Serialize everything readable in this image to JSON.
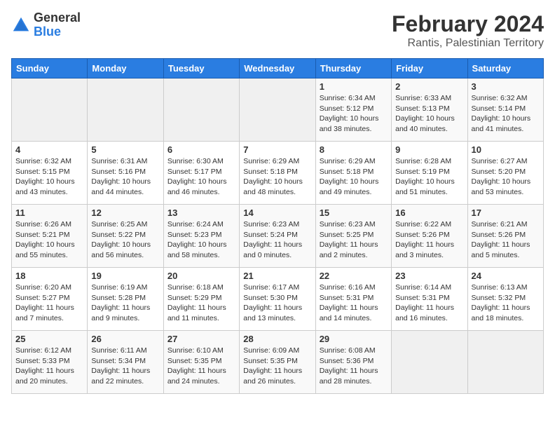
{
  "header": {
    "logo_general": "General",
    "logo_blue": "Blue",
    "title": "February 2024",
    "subtitle": "Rantis, Palestinian Territory"
  },
  "weekdays": [
    "Sunday",
    "Monday",
    "Tuesday",
    "Wednesday",
    "Thursday",
    "Friday",
    "Saturday"
  ],
  "weeks": [
    [
      {
        "day": "",
        "info": ""
      },
      {
        "day": "",
        "info": ""
      },
      {
        "day": "",
        "info": ""
      },
      {
        "day": "",
        "info": ""
      },
      {
        "day": "1",
        "info": "Sunrise: 6:34 AM\nSunset: 5:12 PM\nDaylight: 10 hours\nand 38 minutes."
      },
      {
        "day": "2",
        "info": "Sunrise: 6:33 AM\nSunset: 5:13 PM\nDaylight: 10 hours\nand 40 minutes."
      },
      {
        "day": "3",
        "info": "Sunrise: 6:32 AM\nSunset: 5:14 PM\nDaylight: 10 hours\nand 41 minutes."
      }
    ],
    [
      {
        "day": "4",
        "info": "Sunrise: 6:32 AM\nSunset: 5:15 PM\nDaylight: 10 hours\nand 43 minutes."
      },
      {
        "day": "5",
        "info": "Sunrise: 6:31 AM\nSunset: 5:16 PM\nDaylight: 10 hours\nand 44 minutes."
      },
      {
        "day": "6",
        "info": "Sunrise: 6:30 AM\nSunset: 5:17 PM\nDaylight: 10 hours\nand 46 minutes."
      },
      {
        "day": "7",
        "info": "Sunrise: 6:29 AM\nSunset: 5:18 PM\nDaylight: 10 hours\nand 48 minutes."
      },
      {
        "day": "8",
        "info": "Sunrise: 6:29 AM\nSunset: 5:18 PM\nDaylight: 10 hours\nand 49 minutes."
      },
      {
        "day": "9",
        "info": "Sunrise: 6:28 AM\nSunset: 5:19 PM\nDaylight: 10 hours\nand 51 minutes."
      },
      {
        "day": "10",
        "info": "Sunrise: 6:27 AM\nSunset: 5:20 PM\nDaylight: 10 hours\nand 53 minutes."
      }
    ],
    [
      {
        "day": "11",
        "info": "Sunrise: 6:26 AM\nSunset: 5:21 PM\nDaylight: 10 hours\nand 55 minutes."
      },
      {
        "day": "12",
        "info": "Sunrise: 6:25 AM\nSunset: 5:22 PM\nDaylight: 10 hours\nand 56 minutes."
      },
      {
        "day": "13",
        "info": "Sunrise: 6:24 AM\nSunset: 5:23 PM\nDaylight: 10 hours\nand 58 minutes."
      },
      {
        "day": "14",
        "info": "Sunrise: 6:23 AM\nSunset: 5:24 PM\nDaylight: 11 hours\nand 0 minutes."
      },
      {
        "day": "15",
        "info": "Sunrise: 6:23 AM\nSunset: 5:25 PM\nDaylight: 11 hours\nand 2 minutes."
      },
      {
        "day": "16",
        "info": "Sunrise: 6:22 AM\nSunset: 5:26 PM\nDaylight: 11 hours\nand 3 minutes."
      },
      {
        "day": "17",
        "info": "Sunrise: 6:21 AM\nSunset: 5:26 PM\nDaylight: 11 hours\nand 5 minutes."
      }
    ],
    [
      {
        "day": "18",
        "info": "Sunrise: 6:20 AM\nSunset: 5:27 PM\nDaylight: 11 hours\nand 7 minutes."
      },
      {
        "day": "19",
        "info": "Sunrise: 6:19 AM\nSunset: 5:28 PM\nDaylight: 11 hours\nand 9 minutes."
      },
      {
        "day": "20",
        "info": "Sunrise: 6:18 AM\nSunset: 5:29 PM\nDaylight: 11 hours\nand 11 minutes."
      },
      {
        "day": "21",
        "info": "Sunrise: 6:17 AM\nSunset: 5:30 PM\nDaylight: 11 hours\nand 13 minutes."
      },
      {
        "day": "22",
        "info": "Sunrise: 6:16 AM\nSunset: 5:31 PM\nDaylight: 11 hours\nand 14 minutes."
      },
      {
        "day": "23",
        "info": "Sunrise: 6:14 AM\nSunset: 5:31 PM\nDaylight: 11 hours\nand 16 minutes."
      },
      {
        "day": "24",
        "info": "Sunrise: 6:13 AM\nSunset: 5:32 PM\nDaylight: 11 hours\nand 18 minutes."
      }
    ],
    [
      {
        "day": "25",
        "info": "Sunrise: 6:12 AM\nSunset: 5:33 PM\nDaylight: 11 hours\nand 20 minutes."
      },
      {
        "day": "26",
        "info": "Sunrise: 6:11 AM\nSunset: 5:34 PM\nDaylight: 11 hours\nand 22 minutes."
      },
      {
        "day": "27",
        "info": "Sunrise: 6:10 AM\nSunset: 5:35 PM\nDaylight: 11 hours\nand 24 minutes."
      },
      {
        "day": "28",
        "info": "Sunrise: 6:09 AM\nSunset: 5:35 PM\nDaylight: 11 hours\nand 26 minutes."
      },
      {
        "day": "29",
        "info": "Sunrise: 6:08 AM\nSunset: 5:36 PM\nDaylight: 11 hours\nand 28 minutes."
      },
      {
        "day": "",
        "info": ""
      },
      {
        "day": "",
        "info": ""
      }
    ]
  ]
}
